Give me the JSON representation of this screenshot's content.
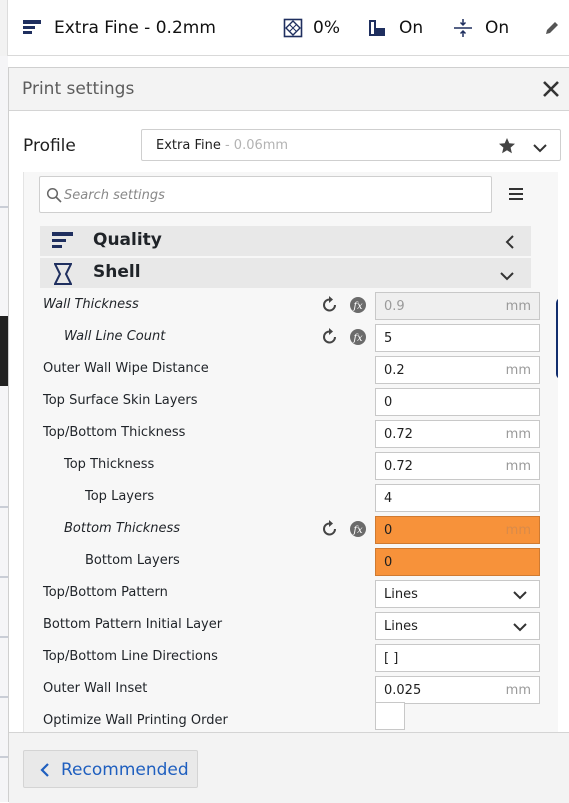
{
  "topbar": {
    "profile_name": "Extra Fine - 0.2mm",
    "infill_value": "0%",
    "support_value": "On",
    "adhesion_value": "On"
  },
  "panel": {
    "title": "Print settings",
    "profile_label": "Profile",
    "profile_name": "Extra Fine",
    "profile_sub": " - 0.06mm"
  },
  "search": {
    "placeholder": "Search settings"
  },
  "categories": [
    {
      "label": "Quality",
      "icon": "quality-icon",
      "expanded": false
    },
    {
      "label": "Shell",
      "icon": "shell-icon",
      "expanded": true
    }
  ],
  "settings": [
    {
      "label": "Wall Thickness",
      "italic": true,
      "indent": 0,
      "value": "0.9",
      "unit": "mm",
      "reset": true,
      "fx": true,
      "state": "disabled"
    },
    {
      "label": "Wall Line Count",
      "italic": true,
      "indent": 1,
      "value": "5",
      "unit": "",
      "reset": true,
      "fx": true,
      "state": "normal"
    },
    {
      "label": "Outer Wall Wipe Distance",
      "italic": false,
      "indent": 0,
      "value": "0.2",
      "unit": "mm",
      "state": "normal"
    },
    {
      "label": "Top Surface Skin Layers",
      "italic": false,
      "indent": 0,
      "value": "0",
      "unit": "",
      "state": "normal"
    },
    {
      "label": "Top/Bottom Thickness",
      "italic": false,
      "indent": 0,
      "value": "0.72",
      "unit": "mm",
      "state": "normal"
    },
    {
      "label": "Top Thickness",
      "italic": false,
      "indent": 1,
      "value": "0.72",
      "unit": "mm",
      "state": "normal"
    },
    {
      "label": "Top Layers",
      "italic": false,
      "indent": 2,
      "value": "4",
      "unit": "",
      "state": "normal"
    },
    {
      "label": "Bottom Thickness",
      "italic": true,
      "indent": 1,
      "value": "0",
      "unit": "mm",
      "reset": true,
      "fx": true,
      "state": "warning"
    },
    {
      "label": "Bottom Layers",
      "italic": false,
      "indent": 2,
      "value": "0",
      "unit": "",
      "state": "warning"
    },
    {
      "label": "Top/Bottom Pattern",
      "italic": false,
      "indent": 0,
      "value": "Lines",
      "type": "select"
    },
    {
      "label": "Bottom Pattern Initial Layer",
      "italic": false,
      "indent": 0,
      "value": "Lines",
      "type": "select"
    },
    {
      "label": "Top/Bottom Line Directions",
      "italic": false,
      "indent": 0,
      "value": "[ ]",
      "unit": "",
      "state": "normal"
    },
    {
      "label": "Outer Wall Inset",
      "italic": false,
      "indent": 0,
      "value": "0.025",
      "unit": "mm",
      "state": "normal"
    },
    {
      "label": "Optimize Wall Printing Order",
      "italic": false,
      "indent": 0,
      "type": "checkbox",
      "checked": false
    }
  ],
  "footer": {
    "recommended_label": "Recommended"
  },
  "colors": {
    "accent": "#1f5fbf",
    "warning": "#f7923a",
    "scrollbar": "#122e6e"
  }
}
